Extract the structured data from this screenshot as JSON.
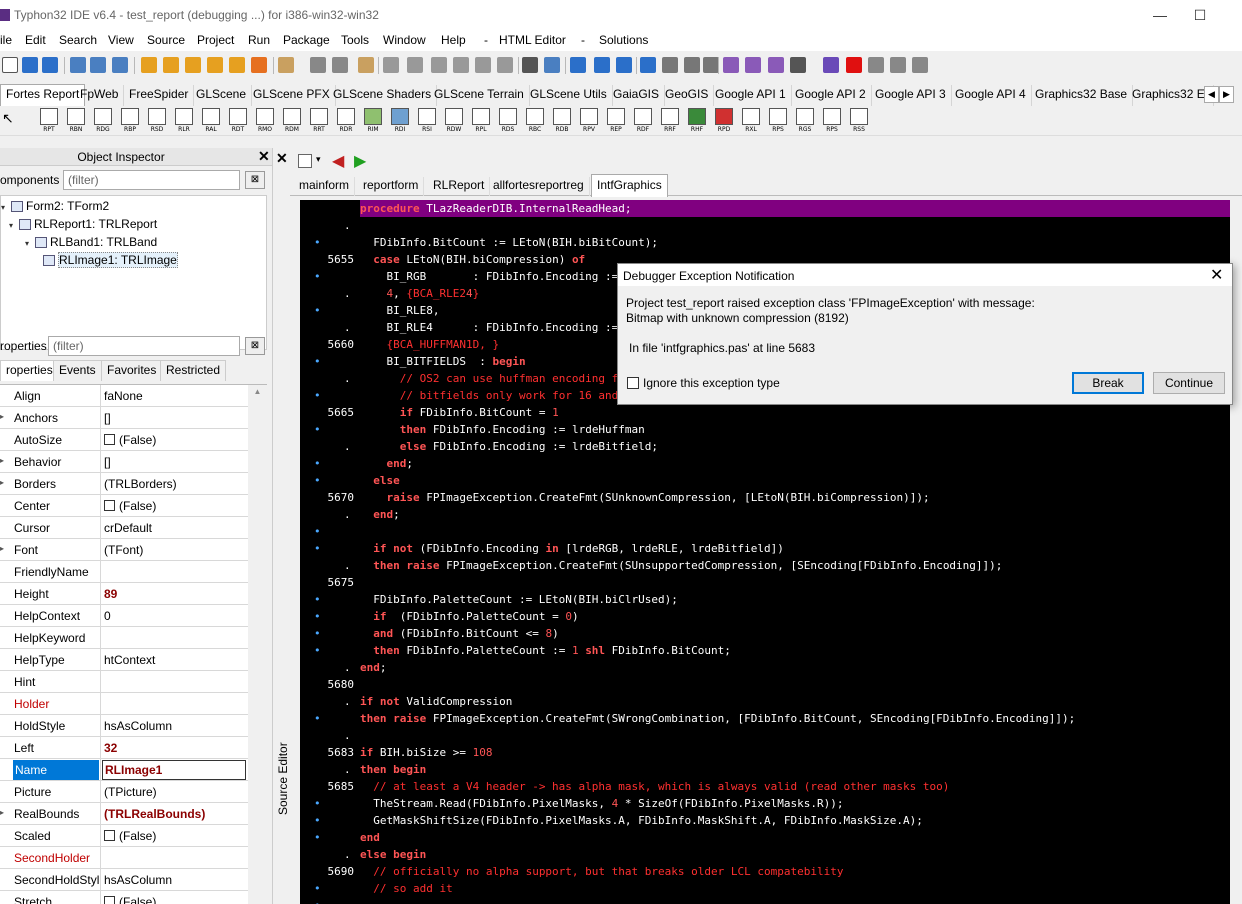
{
  "window": {
    "title": "Typhon32 IDE v6.4 - test_report (debugging ...) for i386-win32-win32",
    "minimize": "—",
    "maximize": "☐"
  },
  "menu": [
    "ile",
    "Edit",
    "Search",
    "View",
    "Source",
    "Project",
    "Run",
    "Package",
    "Tools",
    "Window",
    "Help",
    "-",
    "HTML Editor",
    "-",
    "Solutions"
  ],
  "palette_tabs": [
    "Fortes Report",
    "FpWeb",
    "FreeSpider",
    "GLScene",
    "GLScene PFX",
    "GLScene Shaders",
    "GLScene Terrain",
    "GLScene Utils",
    "GaiaGIS",
    "GeoGIS",
    "Google API 1",
    "Google API 2",
    "Google API 3",
    "Google API 4",
    "Graphics32 Base",
    "Graphics32 E:"
  ],
  "palette_components": [
    "RPT",
    "RBN",
    "RDG",
    "RBP",
    "RSD",
    "RLR",
    "RAL",
    "RDT",
    "RMO",
    "RDM",
    "RRT",
    "RDR",
    "RIM",
    "RDI",
    "RSI",
    "RDW",
    "RPL",
    "RDS",
    "RBC",
    "RDB",
    "RPV",
    "REP",
    "RDF",
    "RRF",
    "RHF",
    "RPD",
    "RXL",
    "RPS",
    "RGS",
    "RPS",
    "RSS"
  ],
  "object_inspector": {
    "title": "Object Inspector",
    "components_label": "omponents",
    "components_filter": "(filter)",
    "tree": [
      {
        "label": "Form2: TForm2",
        "level": 0
      },
      {
        "label": "RLReport1: TRLReport",
        "level": 1
      },
      {
        "label": "RLBand1: TRLBand",
        "level": 2
      },
      {
        "label": "RLImage1: TRLImage",
        "level": 3
      }
    ],
    "properties_label": "roperties",
    "properties_filter": "(filter)",
    "tabs": [
      "roperties",
      "Events",
      "Favorites",
      "Restricted"
    ],
    "props": [
      {
        "name": "Align",
        "value": "faNone"
      },
      {
        "name": "Anchors",
        "value": "[]"
      },
      {
        "name": "AutoSize",
        "value": "(False)"
      },
      {
        "name": "Behavior",
        "value": "[]"
      },
      {
        "name": "Borders",
        "value": "(TRLBorders)"
      },
      {
        "name": "Center",
        "value": "(False)"
      },
      {
        "name": "Cursor",
        "value": "crDefault"
      },
      {
        "name": "Font",
        "value": "(TFont)"
      },
      {
        "name": "FriendlyName",
        "value": ""
      },
      {
        "name": "Height",
        "value": "89"
      },
      {
        "name": "HelpContext",
        "value": "0"
      },
      {
        "name": "HelpKeyword",
        "value": ""
      },
      {
        "name": "HelpType",
        "value": "htContext"
      },
      {
        "name": "Hint",
        "value": ""
      },
      {
        "name": "Holder",
        "value": ""
      },
      {
        "name": "HoldStyle",
        "value": "hsAsColumn"
      },
      {
        "name": "Left",
        "value": "32"
      },
      {
        "name": "Name",
        "value": "RLImage1"
      },
      {
        "name": "Picture",
        "value": "(TPicture)"
      },
      {
        "name": "RealBounds",
        "value": "(TRLRealBounds)"
      },
      {
        "name": "Scaled",
        "value": "(False)"
      },
      {
        "name": "SecondHolder",
        "value": ""
      },
      {
        "name": "SecondHoldStyl",
        "value": "hsAsColumn"
      },
      {
        "name": "Stretch",
        "value": "(False)"
      }
    ]
  },
  "source_editor": {
    "label": "Source Editor",
    "tabs": [
      "mainform",
      "reportform",
      "RLReport",
      "allfortesreportreg",
      "IntfGraphics"
    ],
    "gutter": [
      "",
      ".",
      "•",
      "5655",
      "•",
      ".",
      "•",
      ".",
      "5660",
      "•",
      ".",
      "•",
      "5665",
      "•",
      ".",
      "•",
      "•",
      "5670",
      ".",
      "•",
      "•",
      ".",
      "5675",
      "•",
      "•",
      "•",
      "•",
      ".",
      "5680",
      ".",
      "•",
      ".",
      "5683",
      ".",
      "5685",
      "•",
      "•",
      "•",
      ".",
      "5690",
      "•",
      "•"
    ],
    "lines": [
      "procedure TLazReaderDIB.InternalReadHead;",
      "",
      "  FDibInfo.BitCount := LEtoN(BIH.biBitCount);",
      "  case LEtoN(BIH.biCompression) of",
      "    BI_RGB       : FDibInfo.Encoding := lrdeRGB;",
      "    4, {BCA_RLE24}",
      "    BI_RLE8,",
      "    BI_RLE4      : FDibInfo.Encoding := lrdeRLE;",
      "    {BCA_HUFFMAN1D, }",
      "    BI_BITFIELDS  : begin",
      "      // OS2 can use huffman encoding for mono bitmaps",
      "      // bitfields only work for 16 and 32",
      "      if FDibInfo.BitCount = 1",
      "      then FDibInfo.Encoding := lrdeHuffman",
      "      else FDibInfo.Encoding := lrdeBitfield;",
      "    end;",
      "  else",
      "    raise FPImageException.CreateFmt(SUnknownCompression, [LEtoN(BIH.biCompression)]);",
      "  end;",
      "",
      "  if not (FDibInfo.Encoding in [lrdeRGB, lrdeRLE, lrdeBitfield])",
      "  then raise FPImageException.CreateFmt(SUnsupportedCompression, [SEncoding[FDibInfo.Encoding]]);",
      "",
      "  FDibInfo.PaletteCount := LEtoN(BIH.biClrUsed);",
      "  if  (FDibInfo.PaletteCount = 0)",
      "  and (FDibInfo.BitCount <= 8)",
      "  then FDibInfo.PaletteCount := 1 shl FDibInfo.BitCount;",
      "end;",
      "",
      "if not ValidCompression",
      "then raise FPImageException.CreateFmt(SWrongCombination, [FDibInfo.BitCount, SEncoding[FDibInfo.Encoding]]);",
      "",
      "if BIH.biSize >= 108",
      "then begin",
      "  // at least a V4 header -> has alpha mask, which is always valid (read other masks too)",
      "  TheStream.Read(FDibInfo.PixelMasks, 4 * SizeOf(FDibInfo.PixelMasks.R));",
      "  GetMaskShiftSize(FDibInfo.PixelMasks.A, FDibInfo.MaskShift.A, FDibInfo.MaskSize.A);",
      "end",
      "else begin",
      "  // officially no alpha support, but that breaks older LCL compatebility",
      "  // so add it"
    ]
  },
  "dialog": {
    "title": "Debugger Exception Notification",
    "close": "✕",
    "message1": "Project test_report raised exception class 'FPImageException' with message:",
    "message2": "Bitmap with unknown compression (8192)",
    "message3": "In file 'intfgraphics.pas' at line 5683",
    "ignore_label": "Ignore this exception type",
    "break_label": "Break",
    "continue_label": "Continue"
  }
}
